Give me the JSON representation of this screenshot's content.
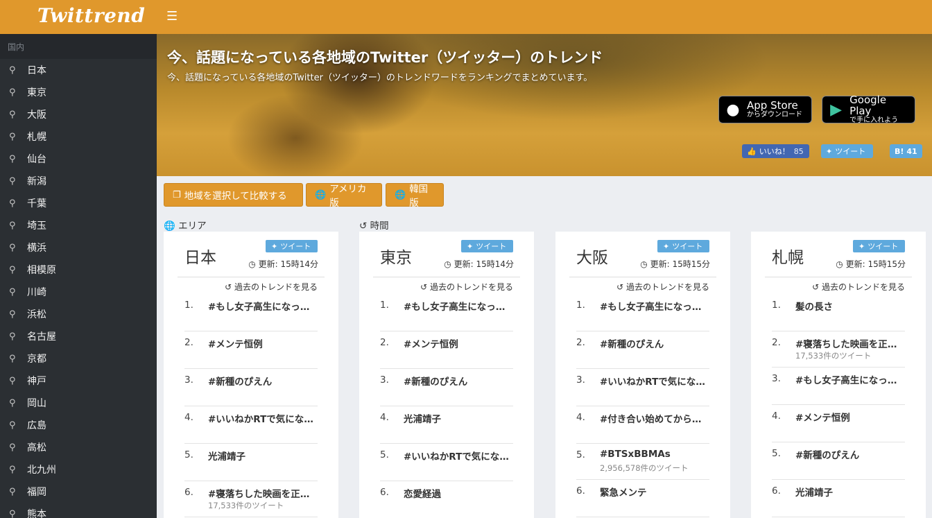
{
  "app": {
    "logo": "Twittrend",
    "menu_icon": "☰"
  },
  "sidebar": {
    "header": "国内",
    "items": [
      "日本",
      "東京",
      "大阪",
      "札幌",
      "仙台",
      "新潟",
      "千葉",
      "埼玉",
      "横浜",
      "相模原",
      "川崎",
      "浜松",
      "名古屋",
      "京都",
      "神戸",
      "岡山",
      "広島",
      "高松",
      "北九州",
      "福岡",
      "熊本"
    ]
  },
  "hero": {
    "title": "今、話題になっている各地域のTwitter（ツイッター）のトレンド",
    "subtitle": "今、話題になっている各地域のTwitter（ツイッター）のトレンドワードをランキングでまとめています。",
    "app_store": {
      "big": "App Store",
      "small": "からダウンロード"
    },
    "google_play": {
      "big": "Google Play",
      "small": "で手に入れよう"
    },
    "like_label": "いいね！",
    "like_count": "85",
    "tweet_label": "ツイート",
    "hatena_label": "B!",
    "hatena_count": "41"
  },
  "actions": {
    "compare": "地域を選択して比較する",
    "america": "アメリカ版",
    "korea": "韓国版"
  },
  "labels": {
    "area": "エリア",
    "time": "時間",
    "tweet": "ツイート",
    "past": "過去のトレンドを見る"
  },
  "cards": [
    {
      "title": "日本",
      "updated": "更新: 15時14分",
      "trends": [
        {
          "rank": "1.",
          "name": "#もし女子高生になったら",
          "count": ""
        },
        {
          "rank": "2.",
          "name": "#メンテ恒例",
          "count": ""
        },
        {
          "rank": "3.",
          "name": "#新種のぴえん",
          "count": ""
        },
        {
          "rank": "4.",
          "name": "#いいねかRTで気になった人",
          "count": ""
        },
        {
          "rank": "5.",
          "name": "光浦靖子",
          "count": ""
        },
        {
          "rank": "6.",
          "name": "#寝落ちした映画を正直に言う",
          "count": "17,533件のツイート"
        }
      ]
    },
    {
      "title": "東京",
      "updated": "更新: 15時14分",
      "trends": [
        {
          "rank": "1.",
          "name": "#もし女子高生になったら",
          "count": ""
        },
        {
          "rank": "2.",
          "name": "#メンテ恒例",
          "count": ""
        },
        {
          "rank": "3.",
          "name": "#新種のぴえん",
          "count": ""
        },
        {
          "rank": "4.",
          "name": "光浦靖子",
          "count": ""
        },
        {
          "rank": "5.",
          "name": "#いいねかRTで気になった人",
          "count": ""
        },
        {
          "rank": "6.",
          "name": "恋愛経過",
          "count": ""
        }
      ]
    },
    {
      "title": "大阪",
      "updated": "更新: 15時15分",
      "trends": [
        {
          "rank": "1.",
          "name": "#もし女子高生になったら",
          "count": ""
        },
        {
          "rank": "2.",
          "name": "#新種のぴえん",
          "count": ""
        },
        {
          "rank": "3.",
          "name": "#いいねかRTで気になった人",
          "count": ""
        },
        {
          "rank": "4.",
          "name": "#付き合い始めてから変わった",
          "count": ""
        },
        {
          "rank": "5.",
          "name": "#BTSxBBMAs",
          "count": "2,956,578件のツイート"
        },
        {
          "rank": "6.",
          "name": "緊急メンテ",
          "count": ""
        }
      ]
    },
    {
      "title": "札幌",
      "updated": "更新: 15時15分",
      "trends": [
        {
          "rank": "1.",
          "name": "髪の長さ",
          "count": ""
        },
        {
          "rank": "2.",
          "name": "#寝落ちした映画を正直に言う",
          "count": "17,533件のツイート"
        },
        {
          "rank": "3.",
          "name": "#もし女子高生になったら",
          "count": ""
        },
        {
          "rank": "4.",
          "name": "#メンテ恒例",
          "count": ""
        },
        {
          "rank": "5.",
          "name": "#新種のぴえん",
          "count": ""
        },
        {
          "rank": "6.",
          "name": "光浦靖子",
          "count": ""
        }
      ]
    }
  ]
}
